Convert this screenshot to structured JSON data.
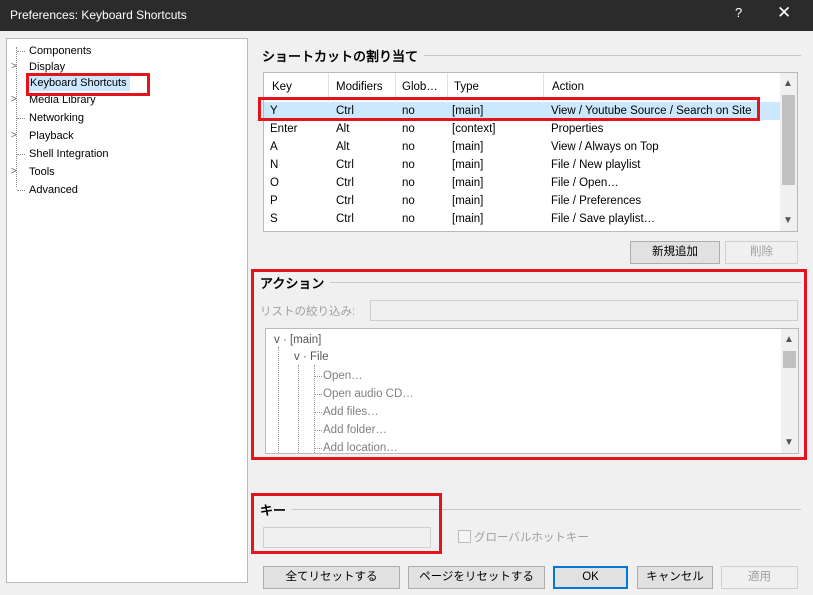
{
  "window": {
    "title": "Preferences: Keyboard Shortcuts",
    "help": "?",
    "close": "✕"
  },
  "tree": {
    "items": [
      {
        "label": "Components",
        "expander": ""
      },
      {
        "label": "Display",
        "expander": ">"
      },
      {
        "label": "Keyboard Shortcuts",
        "expander": "",
        "selected": true
      },
      {
        "label": "Media Library",
        "expander": ">"
      },
      {
        "label": "Networking",
        "expander": ""
      },
      {
        "label": "Playback",
        "expander": ">"
      },
      {
        "label": "Shell Integration",
        "expander": ""
      },
      {
        "label": "Tools",
        "expander": ">"
      },
      {
        "label": "Advanced",
        "expander": ""
      }
    ]
  },
  "assign": {
    "title": "ショートカットの割り当て",
    "columns": [
      "Key",
      "Modifiers",
      "Glob…",
      "Type",
      "Action"
    ],
    "rows": [
      [
        "Y",
        "Ctrl",
        "no",
        "[main]",
        "View / Youtube Source / Search on Site"
      ],
      [
        "Enter",
        "Alt",
        "no",
        "[context]",
        "Properties"
      ],
      [
        "A",
        "Alt",
        "no",
        "[main]",
        "View / Always on Top"
      ],
      [
        "N",
        "Ctrl",
        "no",
        "[main]",
        "File / New playlist"
      ],
      [
        "O",
        "Ctrl",
        "no",
        "[main]",
        "File / Open…"
      ],
      [
        "P",
        "Ctrl",
        "no",
        "[main]",
        "File / Preferences"
      ],
      [
        "S",
        "Ctrl",
        "no",
        "[main]",
        "File / Save playlist…"
      ]
    ],
    "add_label": "新規追加",
    "delete_label": "削除"
  },
  "action": {
    "title": "アクション",
    "filter_label": "リストの絞り込み:",
    "filter_value": "",
    "tree": {
      "root": "[main]",
      "group": "File",
      "items": [
        "Open…",
        "Open audio CD…",
        "Add files…",
        "Add folder…",
        "Add location…"
      ]
    }
  },
  "key": {
    "title": "キー",
    "value": "",
    "global_label": "グローバルホットキー"
  },
  "footer": {
    "reset_all": "全てリセットする",
    "reset_page": "ページをリセットする",
    "ok": "OK",
    "cancel": "キャンセル",
    "apply": "適用"
  },
  "colors": {
    "highlight": "#e3141b",
    "selection": "#cce8ff",
    "titlebar": "#2b2b2b"
  }
}
